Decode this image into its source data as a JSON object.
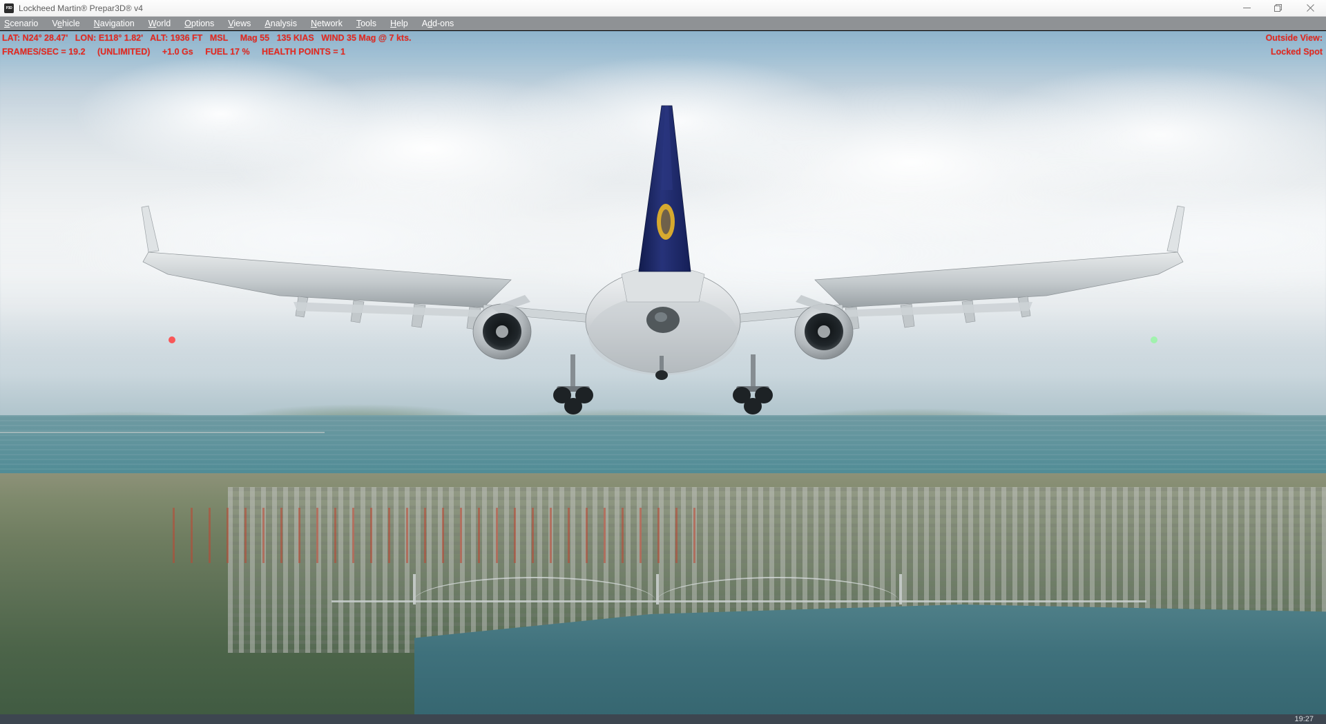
{
  "window": {
    "title": "Lockheed Martin® Prepar3D® v4",
    "app_icon": "p3d-app-icon",
    "controls": {
      "minimize": "minimize-button",
      "restore": "restore-button",
      "close": "close-button"
    }
  },
  "menubar": {
    "items": [
      {
        "label": "Scenario",
        "accel": "S"
      },
      {
        "label": "Vehicle",
        "accel": "e"
      },
      {
        "label": "Navigation",
        "accel": "N"
      },
      {
        "label": "World",
        "accel": "W"
      },
      {
        "label": "Options",
        "accel": "O"
      },
      {
        "label": "Views",
        "accel": "V"
      },
      {
        "label": "Analysis",
        "accel": "A"
      },
      {
        "label": "Network",
        "accel": "N"
      },
      {
        "label": "Tools",
        "accel": "T"
      },
      {
        "label": "Help",
        "accel": "H"
      },
      {
        "label": "Add-ons",
        "accel": "d"
      }
    ]
  },
  "hud": {
    "color": "#e8281f",
    "left": {
      "line1": {
        "lat_label": "LAT:",
        "lat_value": "N24° 28.47'",
        "lon_label": "LON:",
        "lon_value": "E118° 1.82'",
        "alt_label": "ALT:",
        "alt_value": "1936 FT",
        "alt_ref": "MSL",
        "heading": "Mag 55",
        "airspeed": "135 KIAS",
        "wind": "WIND 35 Mag @ 7 kts."
      },
      "line2": {
        "fps": "FRAMES/SEC = 19.2",
        "fps_mode": "(UNLIMITED)",
        "g_load": "+1.0 Gs",
        "fuel": "FUEL 17 %",
        "health": "HEALTH POINTS = 1"
      }
    },
    "right": {
      "view_label": "Outside View:",
      "view_mode": "Locked Spot"
    }
  },
  "scene": {
    "description": "Prepar3D v4 outside spot view of a twin-engine widebody airliner on approach over a coastal city with harbor cranes, a suspension bridge and a river estuary.",
    "sky_color": "#cfd9e0",
    "sea_color": "#4e8a94",
    "land_color": "#5d7055",
    "aircraft": {
      "fuselage_color": "#d7dadc",
      "tail_color": "#1d2a66",
      "tail_logo_color": "#e6b429",
      "engine_color": "#b9bec2"
    }
  },
  "taskbar": {
    "clock": "19:27"
  }
}
